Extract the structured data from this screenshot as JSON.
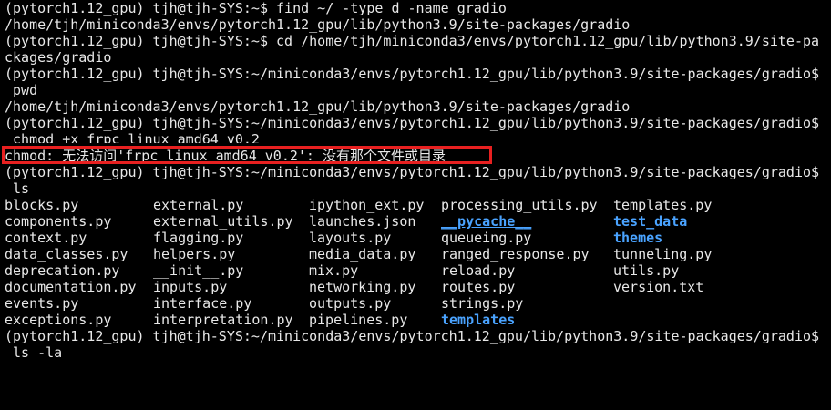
{
  "terminal": {
    "lines": [
      "(pytorch1.12_gpu) tjh@tjh-SYS:~$ find ~/ -type d -name gradio",
      "/home/tjh/miniconda3/envs/pytorch1.12_gpu/lib/python3.9/site-packages/gradio",
      "(pytorch1.12_gpu) tjh@tjh-SYS:~$ cd /home/tjh/miniconda3/envs/pytorch1.12_gpu/lib/python3.9/site-pa",
      "ckages/gradio",
      "(pytorch1.12_gpu) tjh@tjh-SYS:~/miniconda3/envs/pytorch1.12_gpu/lib/python3.9/site-packages/gradio$",
      " pwd",
      "/home/tjh/miniconda3/envs/pytorch1.12_gpu/lib/python3.9/site-packages/gradio",
      "(pytorch1.12_gpu) tjh@tjh-SYS:~/miniconda3/envs/pytorch1.12_gpu/lib/python3.9/site-packages/gradio$",
      " chmod +x frpc_linux_amd64_v0.2",
      "chmod: 无法访问'frpc_linux_amd64_v0.2': 没有那个文件或目录",
      "(pytorch1.12_gpu) tjh@tjh-SYS:~/miniconda3/envs/pytorch1.12_gpu/lib/python3.9/site-packages/gradio$",
      " ls"
    ],
    "ls_rows": [
      [
        "blocks.py",
        "external.py",
        "ipython_ext.py",
        "processing_utils.py",
        "templates.py"
      ],
      [
        "components.py",
        "external_utils.py",
        "launches.json",
        "__pycache__",
        "test_data"
      ],
      [
        "context.py",
        "flagging.py",
        "layouts.py",
        "queueing.py",
        "themes"
      ],
      [
        "data_classes.py",
        "helpers.py",
        "media_data.py",
        "ranged_response.py",
        "tunneling.py"
      ],
      [
        "deprecation.py",
        "__init__.py",
        "mix.py",
        "reload.py",
        "utils.py"
      ],
      [
        "documentation.py",
        "inputs.py",
        "networking.py",
        "routes.py",
        "version.txt"
      ],
      [
        "events.py",
        "interface.py",
        "outputs.py",
        "strings.py",
        ""
      ],
      [
        "exceptions.py",
        "interpretation.py",
        "pipelines.py",
        "templates",
        ""
      ]
    ],
    "tail_lines": [
      "(pytorch1.12_gpu) tjh@tjh-SYS:~/miniconda3/envs/pytorch1.12_gpu/lib/python3.9/site-packages/gradio$",
      " ls -la"
    ],
    "colors": {
      "background": "#000000",
      "text": "#e8e8e8",
      "directory": "#4aa3ff",
      "highlight_box": "#e82020"
    }
  }
}
